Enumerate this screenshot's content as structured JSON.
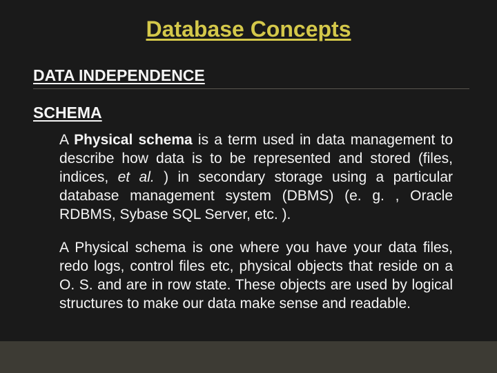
{
  "title": "Database Concepts",
  "subheading1": "DATA INDEPENDENCE",
  "subheading2": "SCHEMA",
  "para1": {
    "lead_a": "A ",
    "lead_bold": "Physical schema",
    "lead_b": " is a term used in data management to describe  how data is  to  be  represented  and  stored  (files, indices, ",
    "italic": "et   al.",
    "tail": " )   in  secondary    storage using    a    particular database management system (DBMS) (e. g. , Oracle RDBMS, Sybase SQL Server, etc. )."
  },
  "para2": " A Physical schema is one where you have your data files, redo logs, control files etc, physical objects that reside on a O. S. and are in row state. These objects are used by logical structures to make our data make sense and readable."
}
